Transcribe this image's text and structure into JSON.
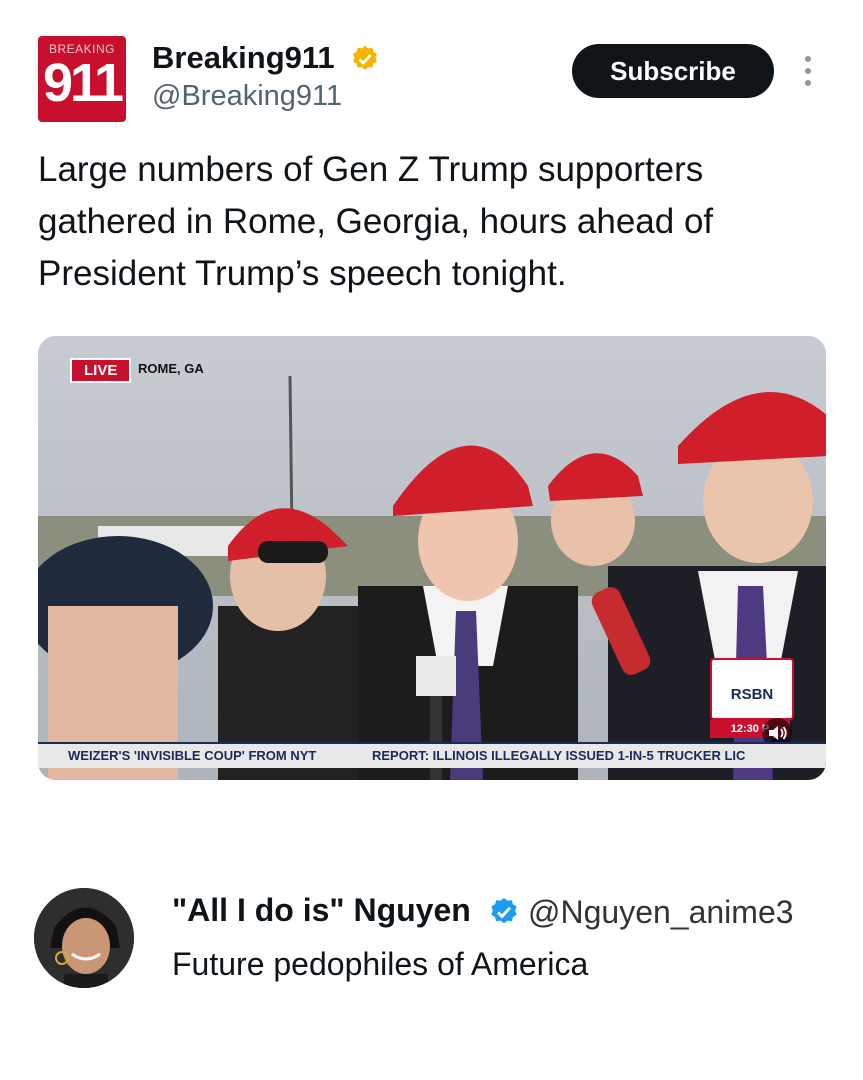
{
  "tweet": {
    "avatar": {
      "top_text": "BREAKING",
      "number": "911"
    },
    "author_name": "Breaking911",
    "handle": "@Breaking911",
    "subscribe_label": "Subscribe",
    "text": "Large numbers of Gen Z Trump supporters gathered in Rome, Georgia, hours ahead of President Trump’s speech tonight.",
    "media": {
      "live_label": "LIVE",
      "location": "ROME, GA",
      "network_logo": "RSBN",
      "time": "12:30 P",
      "ticker_left": "WEIZER'S 'INVISIBLE COUP' FROM NYT",
      "ticker_right": "REPORT: ILLINOIS ILLEGALLY ISSUED 1-IN-5 TRUCKER LIC"
    }
  },
  "reply": {
    "name": "\"All I do is\" Nguyen",
    "handle": "@Nguyen_anime3",
    "text": "Future pedophiles of America"
  },
  "colors": {
    "brand_red": "#c8102e",
    "verified_gold": "#f4b400",
    "verified_blue": "#1d9bf0",
    "subscribe_bg": "#0f1419"
  },
  "icons": [
    "verified-gold-icon",
    "more-icon",
    "speaker-icon",
    "verified-blue-icon"
  ]
}
